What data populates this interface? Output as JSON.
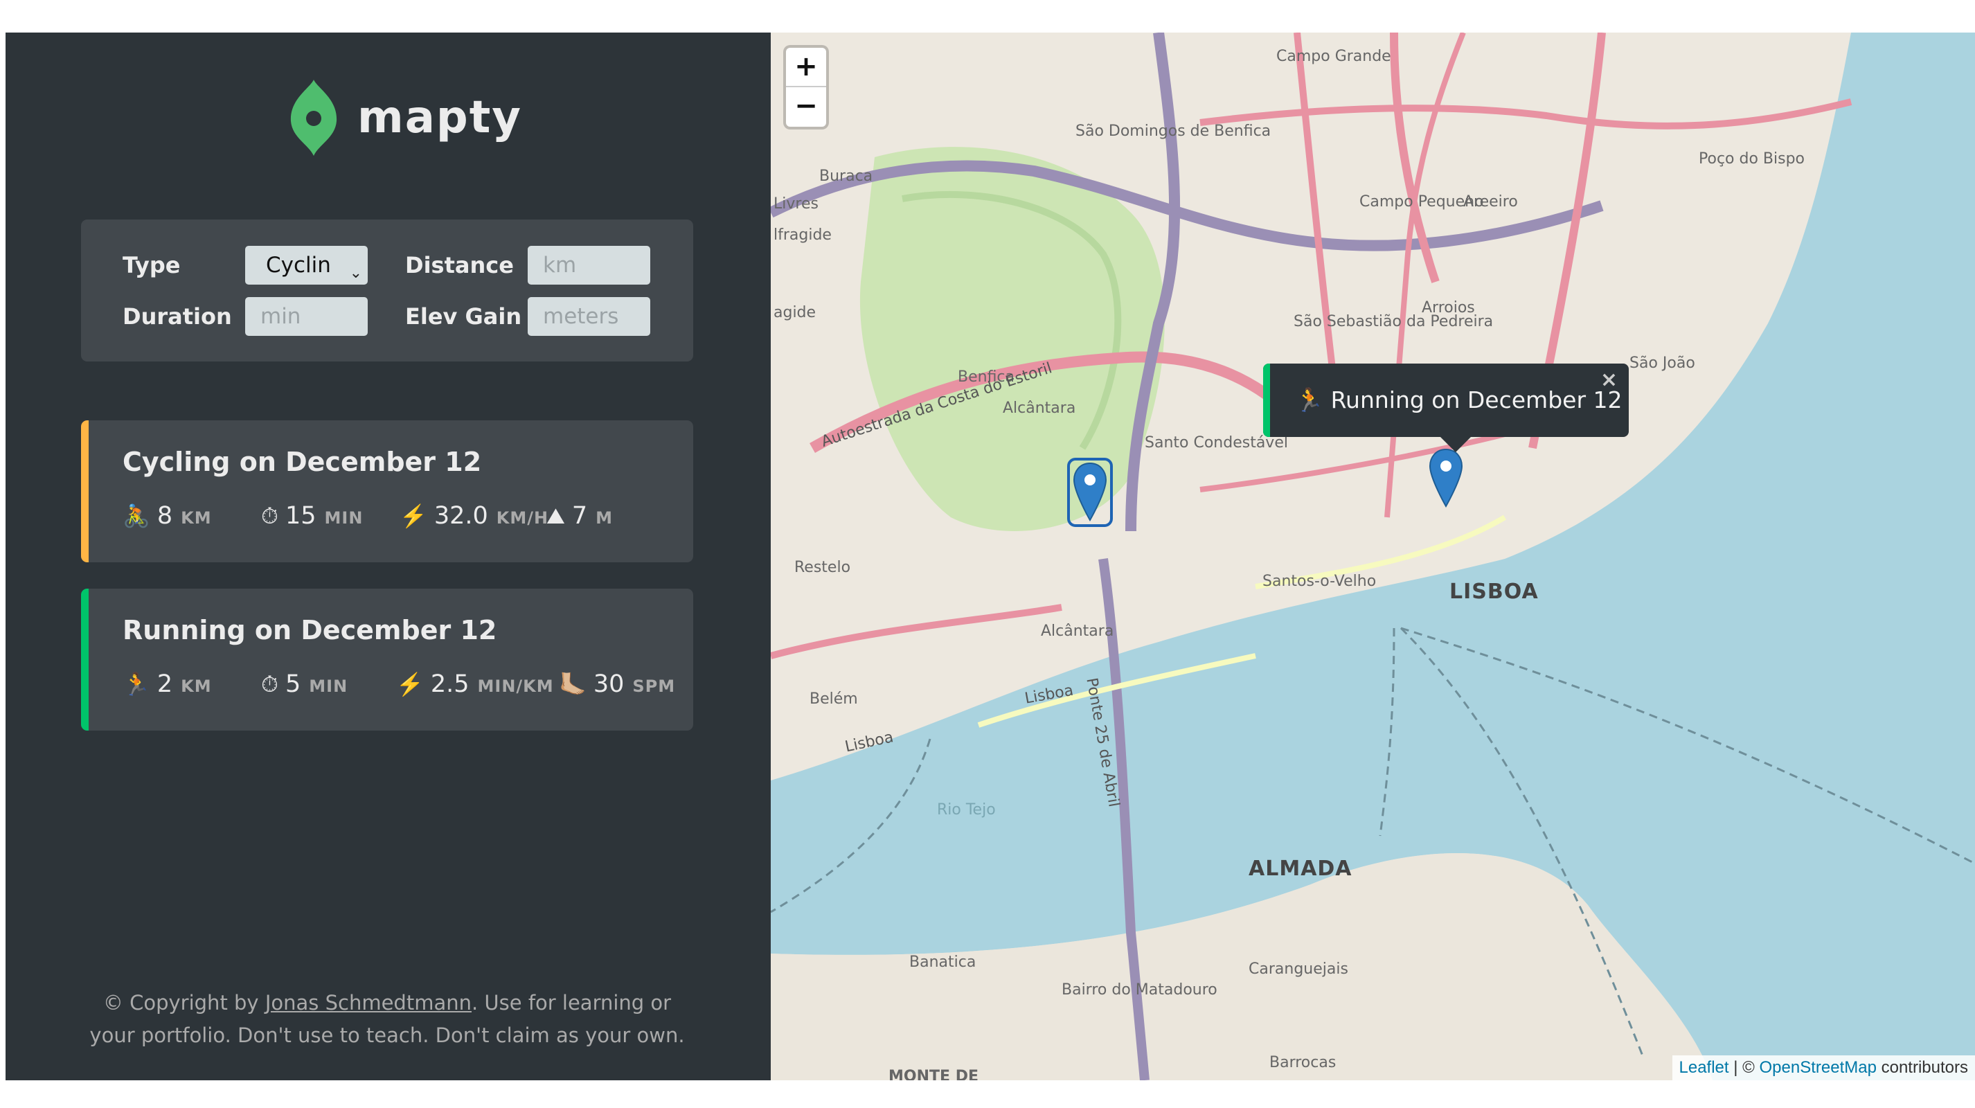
{
  "app": {
    "name": "mapty"
  },
  "colors": {
    "sidebar_bg": "#2d3439",
    "panel_bg": "#42484d",
    "cycling": "#ffb545",
    "running": "#00c46a",
    "logo": "#4fbd6e"
  },
  "form": {
    "type_label": "Type",
    "type_value": "Cyclin",
    "distance_label": "Distance",
    "distance_placeholder": "km",
    "duration_label": "Duration",
    "duration_placeholder": "min",
    "elev_label": "Elev Gain",
    "elev_placeholder": "meters"
  },
  "workouts": [
    {
      "title": "Cycling on December 12",
      "type": "cycling",
      "stats": [
        {
          "icon": "🚴",
          "value": "8",
          "unit": "KM"
        },
        {
          "icon": "⏱",
          "value": "15",
          "unit": "MIN"
        },
        {
          "icon": "⚡️",
          "value": "32.0",
          "unit": "KM/H"
        },
        {
          "icon": "⛰",
          "value": "7",
          "unit": "M"
        }
      ]
    },
    {
      "title": "Running on December 12",
      "type": "running",
      "stats": [
        {
          "icon": "🏃",
          "value": "2",
          "unit": "KM"
        },
        {
          "icon": "⏱",
          "value": "5",
          "unit": "MIN"
        },
        {
          "icon": "⚡️",
          "value": "2.5",
          "unit": "MIN/KM"
        },
        {
          "icon": "🦶🏼",
          "value": "30",
          "unit": "SPM"
        }
      ]
    }
  ],
  "copyright": {
    "prefix": "© Copyright by ",
    "author": "Jonas Schmedtmann",
    "suffix": ". Use for learning or your portfolio. Don't use to teach. Don't claim as your own."
  },
  "map": {
    "zoom_in": "+",
    "zoom_out": "−",
    "popup": {
      "icon": "🏃",
      "text": "Running on December 12",
      "close": "×"
    },
    "attribution": {
      "leaflet": "Leaflet",
      "sep": " | © ",
      "osm": "OpenStreetMap",
      "suffix": " contributors"
    },
    "labels": {
      "lisboa": "LISBOA",
      "almada": "ALMADA",
      "campo_grande": "Campo Grande",
      "sao_domingos": "São Domingos de Benfica",
      "buraca": "Buraca",
      "livres": "Livres",
      "alfragide": "lfragide",
      "agide": "agide",
      "campo_pequeno": "Campo Pequeno",
      "areeiro": "Areeiro",
      "arroios": "Arroios",
      "sao_sebastiao": "São Sebastião da Pedreira",
      "poco_bispo": "Poço do Bispo",
      "benfica": "Benfica",
      "alcantara": "Alcântara",
      "santo_condestavel": "Santo Condestável",
      "sao_joao": "São João",
      "restelo": "Restelo",
      "santos": "Santos-o-Velho",
      "alcantara2": "Alcântara",
      "belem": "Belém",
      "rio_tejo": "Rio Tejo",
      "banatica": "Banatica",
      "bairro": "Bairro do Matadouro",
      "caranguejais": "Caranguejais",
      "barrocas": "Barrocas",
      "monte": "MONTE DE",
      "autoestrada": "Autoestrada da Costa do Estoril",
      "ponte": "Ponte 25 de Abril",
      "lisboa_road": "Lisboa",
      "lisboa_road2": "Lisboa"
    }
  }
}
